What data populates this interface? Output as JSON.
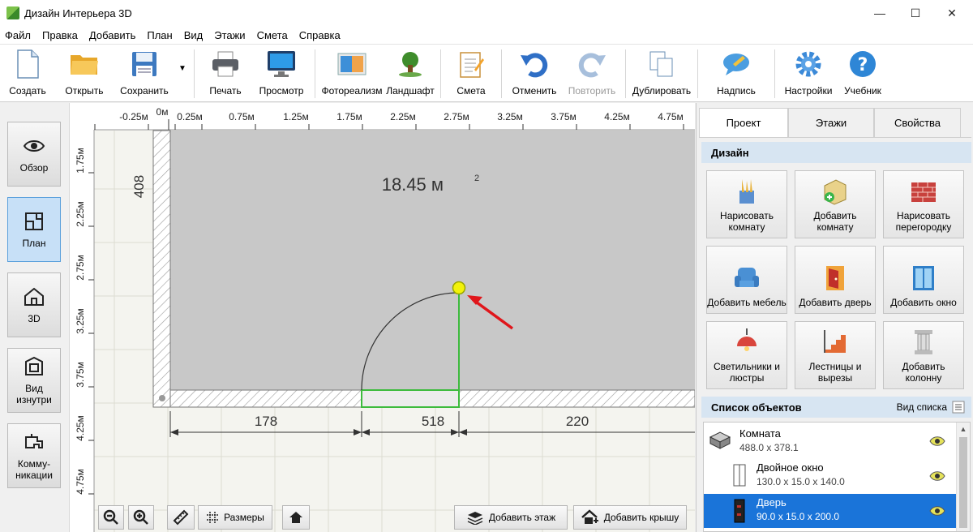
{
  "window": {
    "title": "Дизайн Интерьера 3D",
    "minimize": "—",
    "maximize": "☐",
    "close": "✕"
  },
  "menu": [
    "Файл",
    "Правка",
    "Добавить",
    "План",
    "Вид",
    "Этажи",
    "Смета",
    "Справка"
  ],
  "toolbar": {
    "create": "Создать",
    "open": "Открыть",
    "save": "Сохранить",
    "print": "Печать",
    "preview": "Просмотр",
    "photoreal": "Фотореализм",
    "landscape": "Ландшафт",
    "estimate": "Смета",
    "undo": "Отменить",
    "redo": "Повторить",
    "duplicate": "Дублировать",
    "label": "Надпись",
    "settings": "Настройки",
    "tutorial": "Учебник"
  },
  "nav": {
    "overview": "Обзор",
    "plan": "План",
    "view3d": "3D",
    "inside": "Вид изнутри",
    "utilities": "Комму-никации"
  },
  "ruler": {
    "top": [
      "-0.25м",
      "0м",
      "0.25м",
      "0.75м",
      "1.25м",
      "1.75м",
      "2.25м",
      "2.75м",
      "3.25м",
      "3.75м",
      "4.25м",
      "4.75м"
    ],
    "left": [
      "1.75м",
      "2.25м",
      "2.75м",
      "3.25м",
      "3.75м",
      "4.25м",
      "4.75м"
    ]
  },
  "plan": {
    "area": "18.45 м",
    "area_sup": "2",
    "wall_length": "408",
    "dim_left": "178",
    "dim_door": "518",
    "dim_right": "220"
  },
  "canvas_controls": {
    "sizes": "Размеры",
    "add_floor": "Добавить этаж",
    "add_roof": "Добавить крышу"
  },
  "right_panel": {
    "tabs": [
      "Проект",
      "Этажи",
      "Свойства"
    ],
    "design_header": "Дизайн",
    "design_buttons": [
      "Нарисовать комнату",
      "Добавить комнату",
      "Нарисовать перегородку",
      "Добавить мебель",
      "Добавить дверь",
      "Добавить окно",
      "Светильники и люстры",
      "Лестницы и вырезы",
      "Добавить колонну"
    ],
    "objects_header": "Список объектов",
    "view_list": "Вид списка",
    "objects": [
      {
        "name": "Комната",
        "size": "488.0 x 378.1"
      },
      {
        "name": "Двойное окно",
        "size": "130.0 x 15.0 x 140.0"
      },
      {
        "name": "Дверь",
        "size": "90.0 x 15.0 x 200.0"
      }
    ]
  },
  "colors": {
    "accent": "#1a74d9",
    "door_line": "#3dbb3d",
    "handle": "#f2f20a",
    "arrow": "#e0161b"
  }
}
